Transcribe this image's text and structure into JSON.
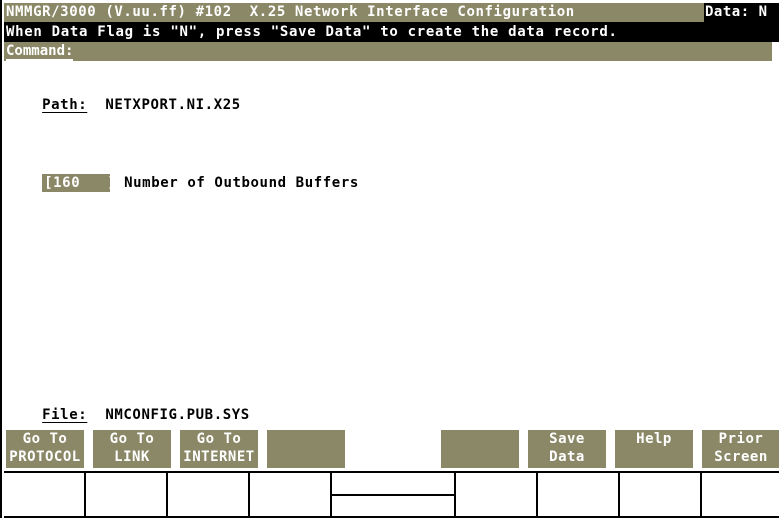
{
  "header": {
    "title": "NMMGR/3000 (V.uu.ff) #102  X.25 Network Interface Configuration",
    "data_flag": "Data: N",
    "message": "When Data Flag is \"N\", press \"Save Data\" to create the data record.",
    "command_label": "Command:",
    "command_value": ""
  },
  "path": {
    "label": "Path:",
    "value": "NETXPORT.NI.X25"
  },
  "fields": [
    {
      "value": "160   ",
      "label": "Number of Outbound Buffers"
    }
  ],
  "file": {
    "label": "File:",
    "value": "NMCONFIG.PUB.SYS"
  },
  "function_keys": [
    {
      "line1": "Go To",
      "line2": "PROTOCOL"
    },
    {
      "line1": "Go To",
      "line2": "LINK"
    },
    {
      "line1": "Go To",
      "line2": "INTERNET"
    },
    {
      "line1": "",
      "line2": ""
    },
    {
      "line1": "",
      "line2": ""
    },
    {
      "line1": "Save",
      "line2": "Data"
    },
    {
      "line1": "Help",
      "line2": ""
    },
    {
      "line1": "Prior",
      "line2": "Screen"
    }
  ],
  "colors": {
    "field_bg": "#8b8868",
    "bar_bg": "#000000",
    "text_on_field": "#ffffff"
  }
}
